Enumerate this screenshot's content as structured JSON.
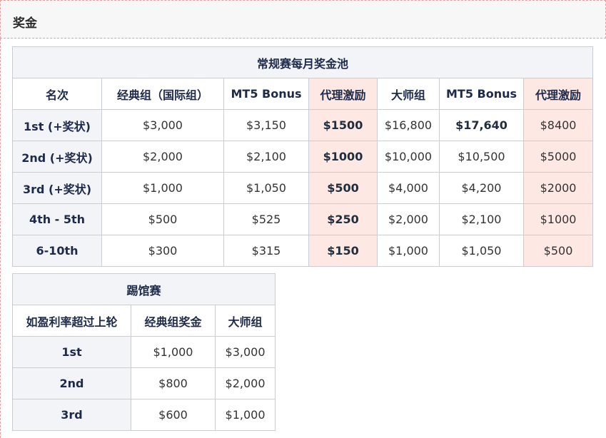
{
  "section": {
    "title": "奖金"
  },
  "regular": {
    "caption": "常规赛每月奖金池",
    "headers": [
      "名次",
      "经典组（国际组）",
      "MT5 Bonus",
      "代理激励",
      "大师组",
      "MT5 Bonus",
      "代理激励"
    ],
    "rows": [
      [
        "1st (+奖状)",
        "$3,000",
        "$3,150",
        "$1500",
        "$16,800",
        "$17,640",
        "$8400"
      ],
      [
        "2nd (+奖状)",
        "$2,000",
        "$2,100",
        "$1000",
        "$10,000",
        "$10,500",
        "$5000"
      ],
      [
        "3rd (+奖状)",
        "$1,000",
        "$1,050",
        "$500",
        "$4,000",
        "$4,200",
        "$2000"
      ],
      [
        "4th - 5th",
        "$500",
        "$525",
        "$250",
        "$2,000",
        "$2,100",
        "$1000"
      ],
      [
        "6-10th",
        "$300",
        "$315",
        "$150",
        "$1,000",
        "$1,050",
        "$500"
      ]
    ]
  },
  "challenge": {
    "caption": "踢馆赛",
    "headers": [
      "如盈利率超过上轮",
      "经典组奖金",
      "大师组"
    ],
    "rows": [
      [
        "1st",
        "$1,000",
        "$3,000"
      ],
      [
        "2nd",
        "$800",
        "$2,000"
      ],
      [
        "3rd",
        "$600",
        "$1,000"
      ]
    ]
  },
  "colors": {
    "header_bg": "#f2f4f7",
    "highlight_bg": "#fde8e4",
    "border": "#c9ced6"
  }
}
